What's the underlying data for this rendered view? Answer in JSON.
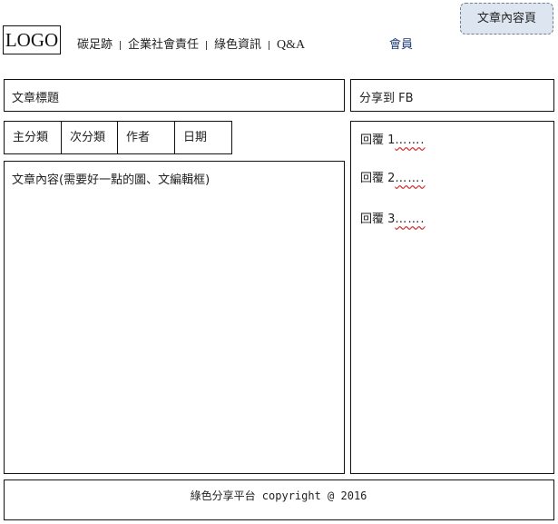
{
  "page_tag": "文章內容頁",
  "header": {
    "logo": "LOGO",
    "nav": [
      "碳足跡",
      "企業社會責任",
      "綠色資訊",
      "Q&A"
    ],
    "member": "會員"
  },
  "article": {
    "title": "文章標題",
    "categories": [
      "主分類",
      "次分類",
      "作者",
      "日期"
    ],
    "content": "文章內容(需要好一點的圖、文編輯框)"
  },
  "sidebar": {
    "share": "分享到 FB",
    "replies": [
      {
        "label": "回覆 1",
        "trail": "……."
      },
      {
        "label": "回覆 2",
        "trail": "……."
      },
      {
        "label": "回覆 3",
        "trail": "……."
      }
    ]
  },
  "footer": {
    "text": "綠色分享平台 copyright @ 2016"
  }
}
